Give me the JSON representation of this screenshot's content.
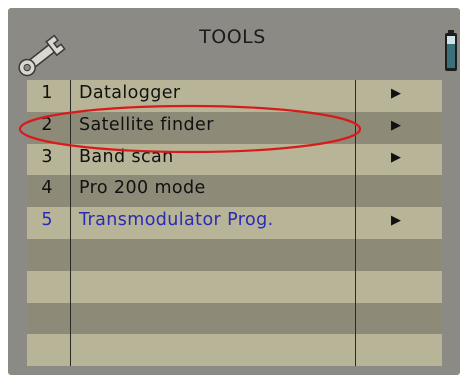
{
  "header": {
    "title": "TOOLS",
    "left_icon": "wrench-icon",
    "right_icon": "battery-icon"
  },
  "menu": {
    "items": [
      {
        "num": "1",
        "label": "Datalogger",
        "has_submenu": true
      },
      {
        "num": "2",
        "label": "Satellite finder",
        "has_submenu": true
      },
      {
        "num": "3",
        "label": "Band scan",
        "has_submenu": true
      },
      {
        "num": "4",
        "label": "Pro 200 mode",
        "has_submenu": false
      },
      {
        "num": "5",
        "label": "Transmodulator Prog.",
        "has_submenu": true
      }
    ],
    "arrow_glyph": "▶",
    "highlighted_item": "5",
    "annotated_item": "2"
  },
  "colors": {
    "screen_bg": "#8c8a85",
    "row_light": "#b7b497",
    "row_dark": "#8d8a78",
    "highlight_text": "#2a2ab8",
    "annotation_ellipse": "#d81a1a"
  }
}
